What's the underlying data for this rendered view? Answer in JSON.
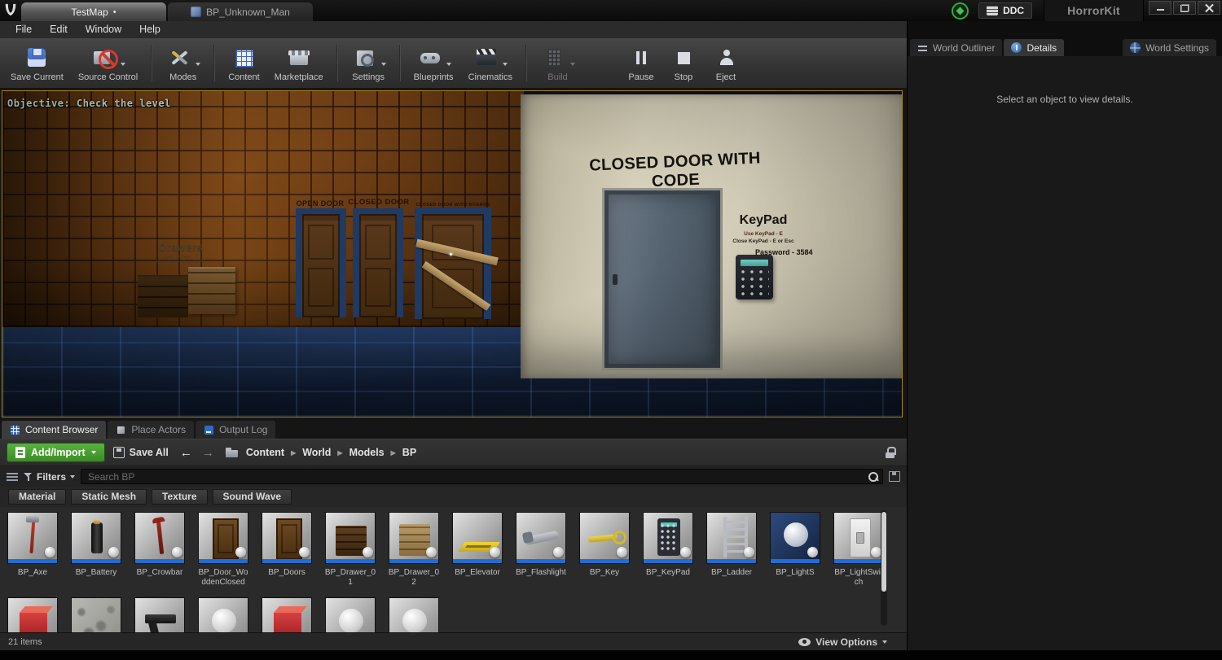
{
  "titlebar": {
    "tabs": [
      {
        "label": "TestMap",
        "active": true,
        "modified": "•"
      },
      {
        "label": "BP_Unknown_Man",
        "icon": "blueprint-icon"
      }
    ],
    "ddc_label": "DDC",
    "app_title": "HorrorKit"
  },
  "menubar": {
    "items": [
      "File",
      "Edit",
      "Window",
      "Help"
    ]
  },
  "toolbar": {
    "buttons": [
      {
        "label": "Save Current",
        "icon": "save-icon"
      },
      {
        "label": "Source Control",
        "icon": "source-control-icon",
        "dropdown": true
      },
      {
        "label": "Modes",
        "icon": "modes-icon",
        "dropdown": true,
        "sep_before": true
      },
      {
        "label": "Content",
        "icon": "content-icon",
        "sep_before": true
      },
      {
        "label": "Marketplace",
        "icon": "marketplace-icon"
      },
      {
        "label": "Settings",
        "icon": "settings-icon",
        "dropdown": true,
        "sep_before": true
      },
      {
        "label": "Blueprints",
        "icon": "blueprints-icon",
        "dropdown": true,
        "sep_before": true
      },
      {
        "label": "Cinematics",
        "icon": "cinematics-icon",
        "dropdown": true
      },
      {
        "label": "Build",
        "icon": "build-icon",
        "dropdown": true,
        "disabled": true,
        "sep_before": true
      },
      {
        "label": "Pause",
        "icon": "pause-icon",
        "gap_before": true
      },
      {
        "label": "Stop",
        "icon": "stop-icon"
      },
      {
        "label": "Eject",
        "icon": "eject-icon"
      }
    ]
  },
  "viewport": {
    "objective": "Objective: Check the level",
    "scene": {
      "drawers_title": "Drawers",
      "drawers_line1": "Open Drawer - E",
      "drawers_line2": "Move mouse Up and Down",
      "open_door": "OPEN DOOR",
      "closed_door": "CLOSED DOOR",
      "closed_door_boards": "CLOSED DOOR WITH BOARDS",
      "closed_door_code": "CLOSED DOOR WITH CODE",
      "keypad_title": "KeyPad",
      "keypad_line1": "Use KeyPad - E",
      "keypad_line2": "Close KeyPad - E or Esc",
      "password": "Password - 3584"
    }
  },
  "panel_tabs": [
    {
      "label": "Content Browser",
      "icon": "content-browser-icon",
      "active": true
    },
    {
      "label": "Place Actors",
      "icon": "place-actors-icon"
    },
    {
      "label": "Output Log",
      "icon": "output-log-icon"
    }
  ],
  "content_browser": {
    "add_import_label": "Add/Import",
    "save_all_label": "Save All",
    "icons": {
      "back": "←",
      "forward": "→"
    },
    "separator": "▶",
    "breadcrumbs": [
      "Content",
      "World",
      "Models",
      "BP"
    ],
    "filters_label": "Filters",
    "search_placeholder": "Search BP",
    "filter_chips": [
      "Material",
      "Static Mesh",
      "Texture",
      "Sound Wave"
    ],
    "assets": [
      {
        "name": "BP_Axe",
        "kind": "axe"
      },
      {
        "name": "BP_Battery",
        "kind": "battery"
      },
      {
        "name": "BP_Crowbar",
        "kind": "crowbar"
      },
      {
        "name": "BP_Door_WoddenClosed",
        "kind": "door"
      },
      {
        "name": "BP_Doors",
        "kind": "door"
      },
      {
        "name": "BP_Drawer_01",
        "kind": "drawer-dark"
      },
      {
        "name": "BP_Drawer_02",
        "kind": "drawer-light"
      },
      {
        "name": "BP_Elevator",
        "kind": "ramp"
      },
      {
        "name": "BP_Flashlight",
        "kind": "flashlight"
      },
      {
        "name": "BP_Key",
        "kind": "key"
      },
      {
        "name": "BP_KeyPad",
        "kind": "keypad"
      },
      {
        "name": "BP_Ladder",
        "kind": "ladder"
      },
      {
        "name": "BP_LightS",
        "kind": "sphere-blue"
      },
      {
        "name": "BP_LightSwitch",
        "kind": "switch"
      }
    ],
    "assets_row2": [
      {
        "kind": "cube-red"
      },
      {
        "kind": "texture"
      },
      {
        "kind": "pistol"
      },
      {
        "kind": "sphere"
      },
      {
        "kind": "cube-red"
      },
      {
        "kind": "sphere"
      },
      {
        "kind": "sphere"
      }
    ],
    "status": "21 items",
    "view_options_label": "View Options"
  },
  "right_panel": {
    "tabs": [
      {
        "label": "World Outliner",
        "icon": "world-outliner-icon"
      },
      {
        "label": "Details",
        "icon": "details-icon",
        "active": true
      },
      {
        "label": "World Settings",
        "icon": "world-settings-icon",
        "right": true
      }
    ],
    "details_message": "Select an object to view details."
  }
}
